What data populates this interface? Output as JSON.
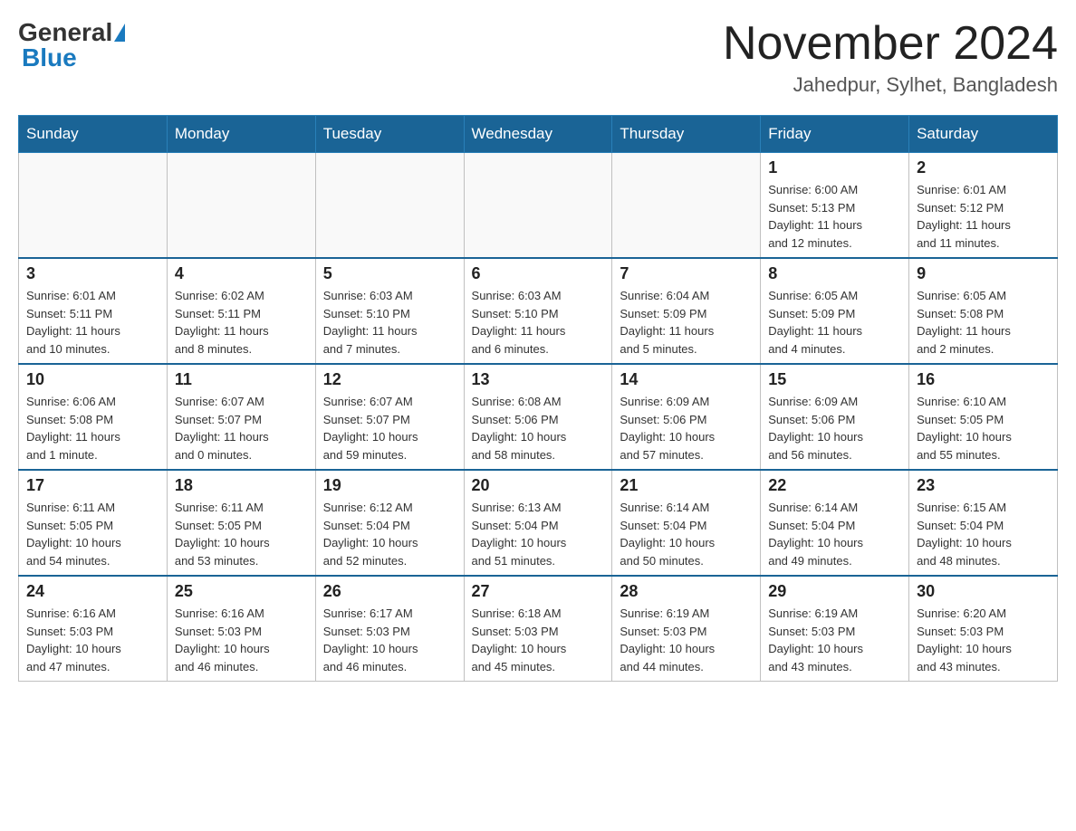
{
  "header": {
    "logo_general": "General",
    "logo_blue": "Blue",
    "month_title": "November 2024",
    "location": "Jahedpur, Sylhet, Bangladesh"
  },
  "weekdays": [
    "Sunday",
    "Monday",
    "Tuesday",
    "Wednesday",
    "Thursday",
    "Friday",
    "Saturday"
  ],
  "weeks": [
    [
      {
        "day": "",
        "info": ""
      },
      {
        "day": "",
        "info": ""
      },
      {
        "day": "",
        "info": ""
      },
      {
        "day": "",
        "info": ""
      },
      {
        "day": "",
        "info": ""
      },
      {
        "day": "1",
        "info": "Sunrise: 6:00 AM\nSunset: 5:13 PM\nDaylight: 11 hours\nand 12 minutes."
      },
      {
        "day": "2",
        "info": "Sunrise: 6:01 AM\nSunset: 5:12 PM\nDaylight: 11 hours\nand 11 minutes."
      }
    ],
    [
      {
        "day": "3",
        "info": "Sunrise: 6:01 AM\nSunset: 5:11 PM\nDaylight: 11 hours\nand 10 minutes."
      },
      {
        "day": "4",
        "info": "Sunrise: 6:02 AM\nSunset: 5:11 PM\nDaylight: 11 hours\nand 8 minutes."
      },
      {
        "day": "5",
        "info": "Sunrise: 6:03 AM\nSunset: 5:10 PM\nDaylight: 11 hours\nand 7 minutes."
      },
      {
        "day": "6",
        "info": "Sunrise: 6:03 AM\nSunset: 5:10 PM\nDaylight: 11 hours\nand 6 minutes."
      },
      {
        "day": "7",
        "info": "Sunrise: 6:04 AM\nSunset: 5:09 PM\nDaylight: 11 hours\nand 5 minutes."
      },
      {
        "day": "8",
        "info": "Sunrise: 6:05 AM\nSunset: 5:09 PM\nDaylight: 11 hours\nand 4 minutes."
      },
      {
        "day": "9",
        "info": "Sunrise: 6:05 AM\nSunset: 5:08 PM\nDaylight: 11 hours\nand 2 minutes."
      }
    ],
    [
      {
        "day": "10",
        "info": "Sunrise: 6:06 AM\nSunset: 5:08 PM\nDaylight: 11 hours\nand 1 minute."
      },
      {
        "day": "11",
        "info": "Sunrise: 6:07 AM\nSunset: 5:07 PM\nDaylight: 11 hours\nand 0 minutes."
      },
      {
        "day": "12",
        "info": "Sunrise: 6:07 AM\nSunset: 5:07 PM\nDaylight: 10 hours\nand 59 minutes."
      },
      {
        "day": "13",
        "info": "Sunrise: 6:08 AM\nSunset: 5:06 PM\nDaylight: 10 hours\nand 58 minutes."
      },
      {
        "day": "14",
        "info": "Sunrise: 6:09 AM\nSunset: 5:06 PM\nDaylight: 10 hours\nand 57 minutes."
      },
      {
        "day": "15",
        "info": "Sunrise: 6:09 AM\nSunset: 5:06 PM\nDaylight: 10 hours\nand 56 minutes."
      },
      {
        "day": "16",
        "info": "Sunrise: 6:10 AM\nSunset: 5:05 PM\nDaylight: 10 hours\nand 55 minutes."
      }
    ],
    [
      {
        "day": "17",
        "info": "Sunrise: 6:11 AM\nSunset: 5:05 PM\nDaylight: 10 hours\nand 54 minutes."
      },
      {
        "day": "18",
        "info": "Sunrise: 6:11 AM\nSunset: 5:05 PM\nDaylight: 10 hours\nand 53 minutes."
      },
      {
        "day": "19",
        "info": "Sunrise: 6:12 AM\nSunset: 5:04 PM\nDaylight: 10 hours\nand 52 minutes."
      },
      {
        "day": "20",
        "info": "Sunrise: 6:13 AM\nSunset: 5:04 PM\nDaylight: 10 hours\nand 51 minutes."
      },
      {
        "day": "21",
        "info": "Sunrise: 6:14 AM\nSunset: 5:04 PM\nDaylight: 10 hours\nand 50 minutes."
      },
      {
        "day": "22",
        "info": "Sunrise: 6:14 AM\nSunset: 5:04 PM\nDaylight: 10 hours\nand 49 minutes."
      },
      {
        "day": "23",
        "info": "Sunrise: 6:15 AM\nSunset: 5:04 PM\nDaylight: 10 hours\nand 48 minutes."
      }
    ],
    [
      {
        "day": "24",
        "info": "Sunrise: 6:16 AM\nSunset: 5:03 PM\nDaylight: 10 hours\nand 47 minutes."
      },
      {
        "day": "25",
        "info": "Sunrise: 6:16 AM\nSunset: 5:03 PM\nDaylight: 10 hours\nand 46 minutes."
      },
      {
        "day": "26",
        "info": "Sunrise: 6:17 AM\nSunset: 5:03 PM\nDaylight: 10 hours\nand 46 minutes."
      },
      {
        "day": "27",
        "info": "Sunrise: 6:18 AM\nSunset: 5:03 PM\nDaylight: 10 hours\nand 45 minutes."
      },
      {
        "day": "28",
        "info": "Sunrise: 6:19 AM\nSunset: 5:03 PM\nDaylight: 10 hours\nand 44 minutes."
      },
      {
        "day": "29",
        "info": "Sunrise: 6:19 AM\nSunset: 5:03 PM\nDaylight: 10 hours\nand 43 minutes."
      },
      {
        "day": "30",
        "info": "Sunrise: 6:20 AM\nSunset: 5:03 PM\nDaylight: 10 hours\nand 43 minutes."
      }
    ]
  ]
}
